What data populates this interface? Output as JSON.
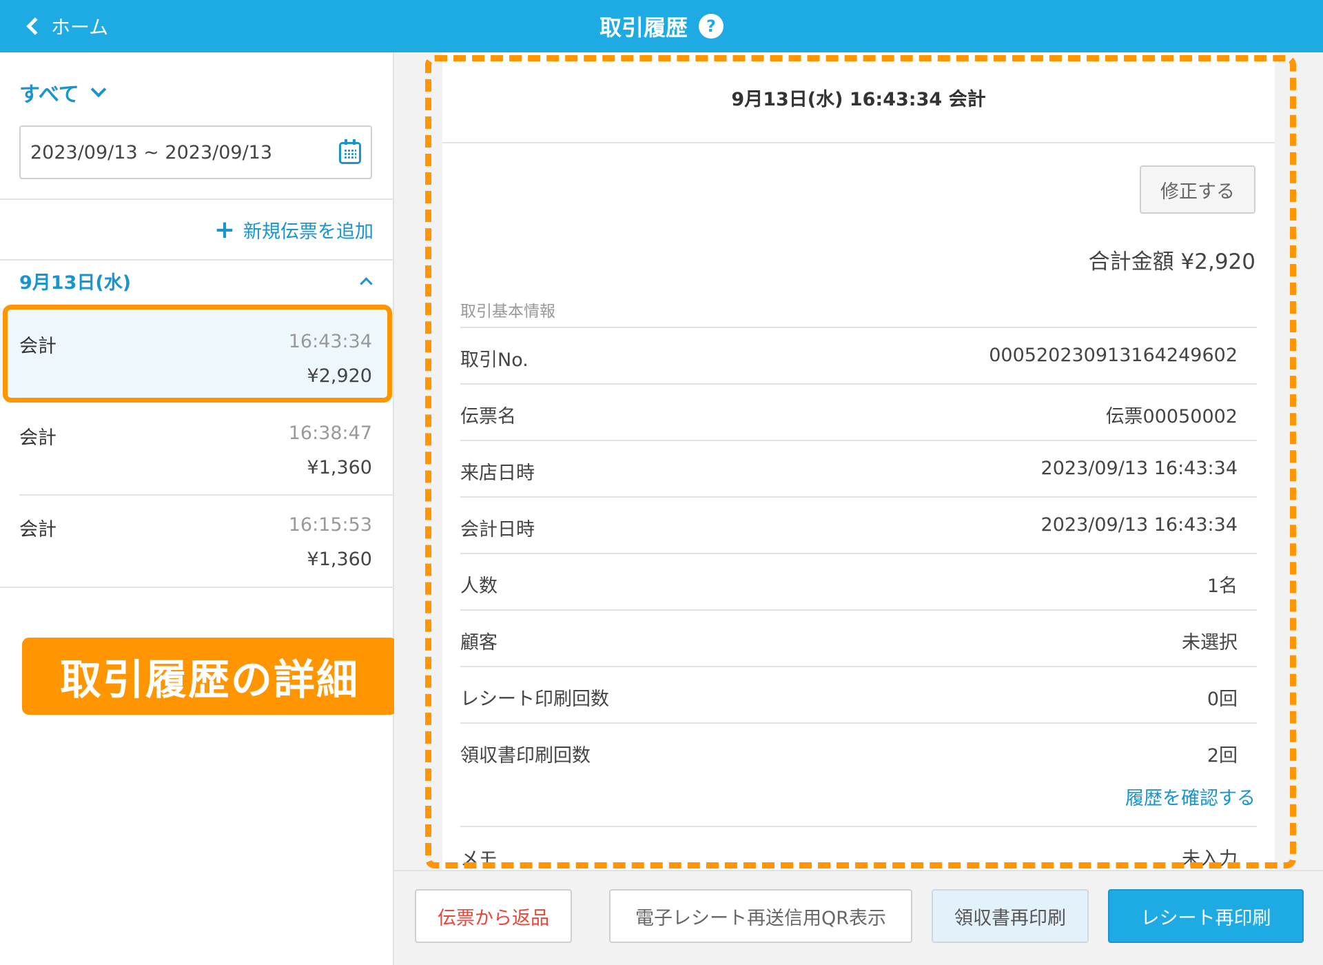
{
  "header": {
    "back_label": "ホーム",
    "title": "取引履歴",
    "help_glyph": "?"
  },
  "sidebar": {
    "filter_label": "すべて",
    "date_range": "2023/09/13 ~ 2023/09/13",
    "add_slip_label": "新規伝票を追加",
    "day_label": "9月13日(水)",
    "transactions": [
      {
        "label": "会計",
        "time": "16:43:34",
        "amount": "¥2,920",
        "selected": true
      },
      {
        "label": "会計",
        "time": "16:38:47",
        "amount": "¥1,360",
        "selected": false
      },
      {
        "label": "会計",
        "time": "16:15:53",
        "amount": "¥1,360",
        "selected": false
      }
    ]
  },
  "callout": {
    "text": "取引履歴の詳細"
  },
  "detail": {
    "heading": "9月13日(水) 16:43:34 会計",
    "edit_label": "修正する",
    "total": "合計金額 ¥2,920",
    "section_label": "取引基本情報",
    "rows": [
      {
        "key": "取引No.",
        "value": "00052023091316424960 2"
      },
      {
        "key": "伝票名",
        "value": "伝票00050002"
      },
      {
        "key": "来店日時",
        "value": "2023/09/13 16:43:34"
      },
      {
        "key": "会計日時",
        "value": "2023/09/13 16:43:34"
      },
      {
        "key": "人数",
        "value": "1名"
      },
      {
        "key": "顧客",
        "value": "未選択"
      },
      {
        "key": "レシート印刷回数",
        "value": "0回"
      },
      {
        "key": "領収書印刷回数",
        "value": "2回"
      },
      {
        "key": "メモ",
        "value": "未入力"
      }
    ],
    "history_link": "履歴を確認する"
  },
  "actions": {
    "return_label": "伝票から返品",
    "qr_label": "電子レシート再送信用QR表示",
    "receipt_label": "領収書再印刷",
    "reprint_label": "レシート再印刷"
  },
  "colors": {
    "brand": "#1eaae3",
    "link": "#1a94cc",
    "highlight": "#ff9500",
    "danger": "#e8473a"
  }
}
